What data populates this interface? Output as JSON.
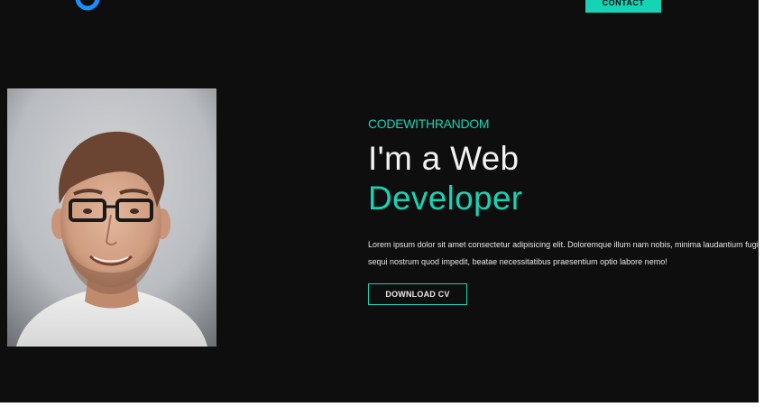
{
  "nav": {
    "logo_icon": "logo-icon",
    "contact_label": "CONTACT"
  },
  "hero": {
    "kicker": "CODEWITHRANDOM",
    "headline_line1": "I'm a Web",
    "headline_line2": "Developer",
    "description": "Lorem ipsum dolor sit amet consectetur adipisicing elit. Doloremque illum nam nobis, minima laudantium fugit sequi nostrum quod impedit, beatae necessitatibus praesentium optio labore nemo!",
    "cta_label": "DOWNLOAD CV"
  },
  "colors": {
    "background": "#0e0e0e",
    "accent": "#17d3b6",
    "text": "#f2f2f2"
  }
}
